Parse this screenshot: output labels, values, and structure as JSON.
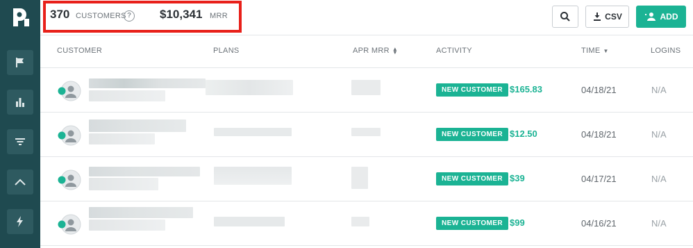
{
  "header": {
    "customer_count": "370",
    "customer_count_label": "CUSTOMERS",
    "mrr_value": "$10,341",
    "mrr_label": "MRR",
    "csv_label": "CSV",
    "add_label": "ADD"
  },
  "sidebar": {
    "items": [
      {
        "icon": "flag-icon"
      },
      {
        "icon": "bar-chart-icon"
      },
      {
        "icon": "filter-icon"
      },
      {
        "icon": "trend-icon"
      },
      {
        "icon": "lightning-icon"
      }
    ]
  },
  "table": {
    "columns": [
      "CUSTOMER",
      "PLANS",
      "APR MRR",
      "ACTIVITY",
      "TIME",
      "LOGINS"
    ],
    "rows": [
      {
        "activity": "NEW CUSTOMER",
        "amount": "$165.83",
        "time": "04/18/21",
        "logins": "N/A"
      },
      {
        "activity": "NEW CUSTOMER",
        "amount": "$12.50",
        "time": "04/18/21",
        "logins": "N/A"
      },
      {
        "activity": "NEW CUSTOMER",
        "amount": "$39",
        "time": "04/17/21",
        "logins": "N/A"
      },
      {
        "activity": "NEW CUSTOMER",
        "amount": "$99",
        "time": "04/16/21",
        "logins": "N/A"
      }
    ]
  },
  "colors": {
    "sidebar": "#1f4a50",
    "accent": "#1bb394",
    "highlight_box": "#e8201a"
  }
}
